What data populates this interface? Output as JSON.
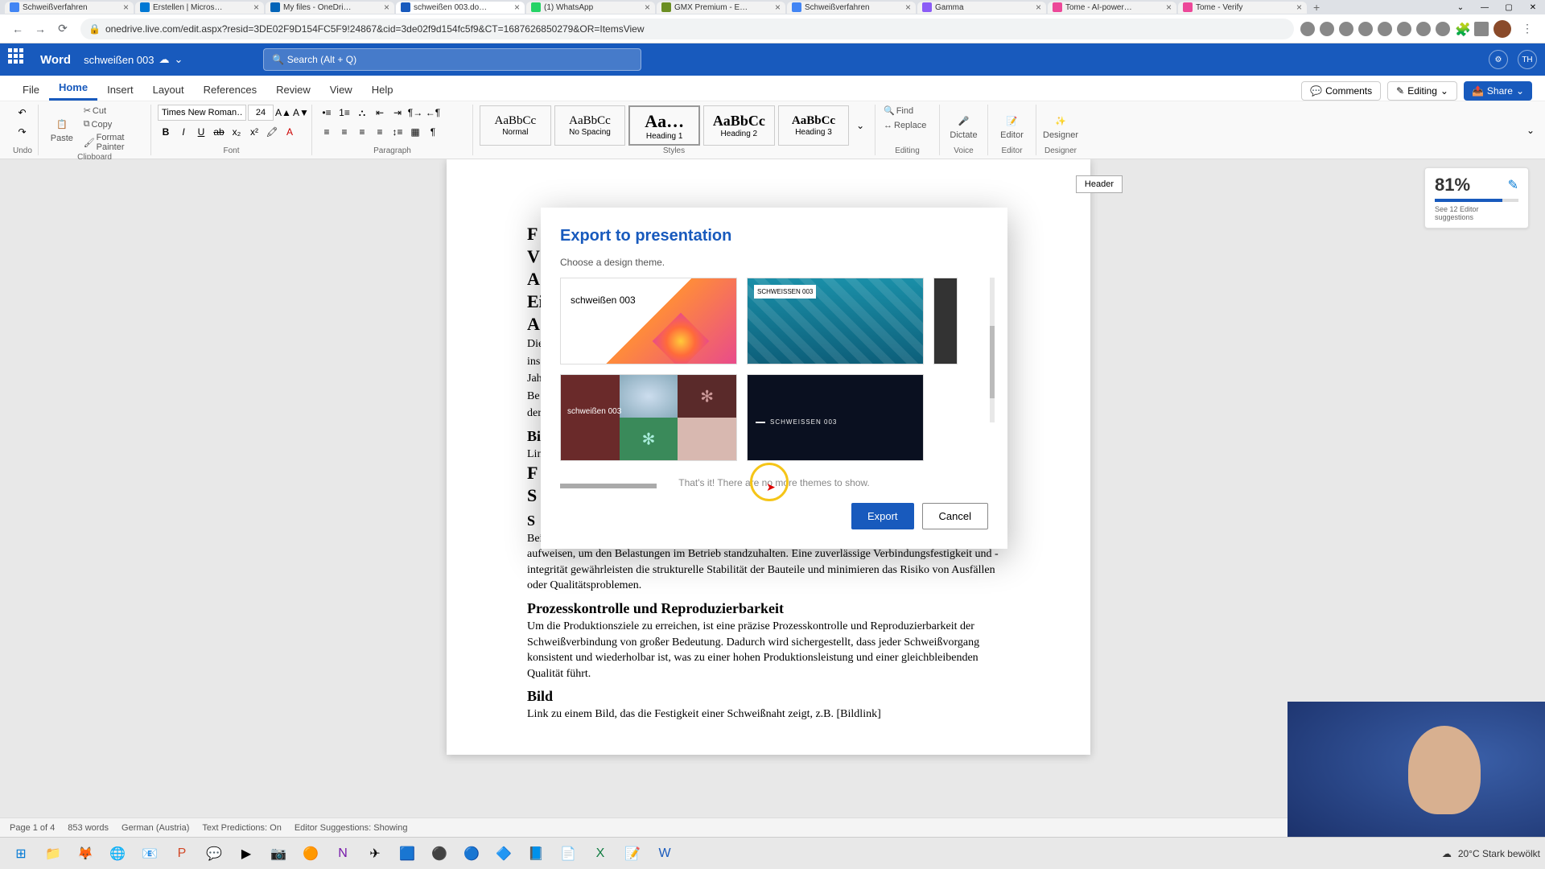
{
  "browser": {
    "tabs": [
      "Schweißverfahren",
      "Erstellen | Micros…",
      "My files - OneDri…",
      "schweißen 003.do…",
      "(1) WhatsApp",
      "GMX Premium - E…",
      "Schweißverfahren",
      "Gamma",
      "Tome - AI-power…",
      "Tome - Verify"
    ],
    "url": "onedrive.live.com/edit.aspx?resid=3DE02F9D154FC5F9!24867&cid=3de02f9d154fc5f9&CT=1687626850279&OR=ItemsView"
  },
  "word": {
    "app": "Word",
    "doc": "schweißen 003",
    "searchPlaceholder": "Search (Alt + Q)",
    "avatar": "TH",
    "tarbs": [
      "File",
      "Home",
      "Insert",
      "Layout",
      "References",
      "Review",
      "View",
      "Help"
    ],
    "comments": "Comments",
    "editing": "Editing",
    "share": "Share"
  },
  "ribbon": {
    "undo": "Undo",
    "paste": "Paste",
    "cut": "Cut",
    "copy": "Copy",
    "formatPainter": "Format Painter",
    "clipboard": "Clipboard",
    "fontName": "Times New Roman…",
    "fontSize": "24",
    "font": "Font",
    "paragraph": "Paragraph",
    "styles": "Styles",
    "stylesList": [
      {
        "preview": "AaBbCc",
        "name": "Normal"
      },
      {
        "preview": "AaBbCc",
        "name": "No Spacing"
      },
      {
        "preview": "Aa…",
        "name": "Heading 1"
      },
      {
        "preview": "AaBbCc",
        "name": "Heading 2"
      },
      {
        "preview": "AaBbCc",
        "name": "Heading 3"
      }
    ],
    "find": "Find",
    "replace": "Replace",
    "editing": "Editing",
    "dictate": "Dictate",
    "voice": "Voice",
    "editor": "Editor",
    "editorGrp": "Editor",
    "designer": "Designer",
    "designerGrp": "Designer"
  },
  "editorScore": {
    "value": "81%",
    "sub": "See 12 Editor suggestions"
  },
  "headerMarker": "Header",
  "document": {
    "lines": [
      "F",
      "V",
      "A",
      "Ei",
      "A"
    ],
    "p1a": "Die",
    "p1b": "ins",
    "p1c": "Jah",
    "p1d": "Be",
    "p1e": "der",
    "h3": "Bi",
    "p2": "Lin",
    "h1b": "F",
    "h2b": "S",
    "h3b": "S",
    "para2": "Bei der großen Serienproduktion ist es entscheidend, dass die Schweißverbindungen eine hohe Festigkeit aufweisen, um den Belastungen im Betrieb standzuhalten. Eine zuverlässige Verbindungsfestigkeit und -integrität gewährleisten die strukturelle Stabilität der Bauteile und minimieren das Risiko von Ausfällen oder Qualitätsproblemen.",
    "h4": "Prozesskontrolle und Reproduzierbarkeit",
    "para3": "Um die Produktionsziele zu erreichen, ist eine präzise Prozesskontrolle und Reproduzierbarkeit der Schweißverbindung von großer Bedeutung. Dadurch wird sichergestellt, dass jeder Schweißvorgang konsistent und wiederholbar ist, was zu einer hohen Produktionsleistung und einer gleichbleibenden Qualität führt.",
    "h5": "Bild",
    "para4": "Link zu einem Bild, das die Festigkeit einer Schweißnaht zeigt, z.B. [Bildlink]"
  },
  "modal": {
    "title": "Export to presentation",
    "sub": "Choose a design theme.",
    "theme1": "schweißen 003",
    "theme2": "SCHWEISSEN 003",
    "theme3": "schweißen 003",
    "theme4": "SCHWEISSEN 003",
    "noMore": "That's it! There are no more themes to show.",
    "export": "Export",
    "cancel": "Cancel"
  },
  "status": {
    "page": "Page 1 of 4",
    "words": "853 words",
    "lang": "German (Austria)",
    "predictions": "Text Predictions: On",
    "suggestions": "Editor Suggestions: Showing"
  },
  "taskbar": {
    "weather": "20°C  Stark bewölkt"
  }
}
